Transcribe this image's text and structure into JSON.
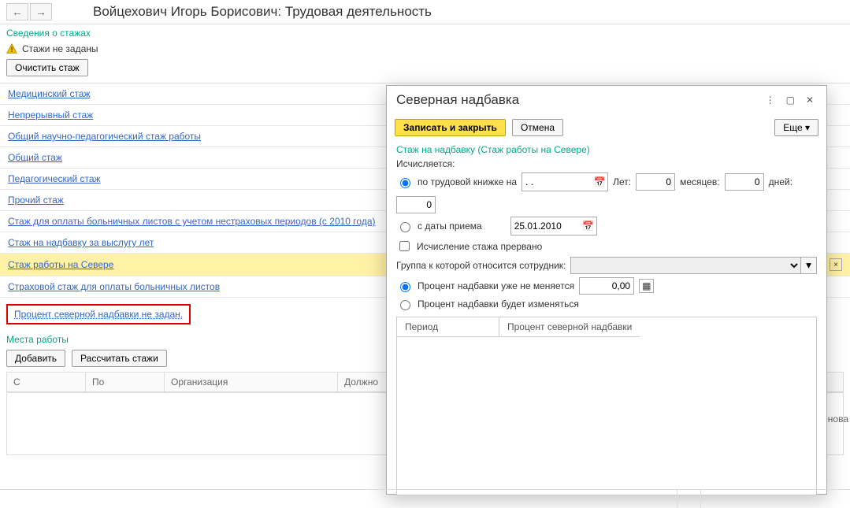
{
  "title": "Войцехович Игорь Борисович: Трудовая деятельность",
  "nav": {
    "back": "←",
    "forward": "→"
  },
  "stazh_info_link": "Сведения о стажах",
  "warn_text": "Стажи не заданы",
  "clear_btn": "Очистить стаж",
  "stages": [
    {
      "label": "Медицинский стаж"
    },
    {
      "label": "Непрерывный стаж"
    },
    {
      "label": "Общий научно-педагогический стаж работы"
    },
    {
      "label": "Общий стаж"
    },
    {
      "label": "Педагогический стаж"
    },
    {
      "label": "Прочий стаж"
    },
    {
      "label": "Стаж для оплаты больничных листов с учетом нестраховых периодов (с 2010 года)"
    },
    {
      "label": "Стаж на надбавку за выслугу лет"
    },
    {
      "label": "Стаж работы на Севере",
      "selected": true,
      "clearable": true
    },
    {
      "label": "Страховой стаж для оплаты больничных листов"
    }
  ],
  "percent_warning": "Процент северной надбавки не задан.",
  "places": {
    "header": "Места работы",
    "add": "Добавить",
    "calc": "Рассчитать стажи",
    "cols": {
      "from": "С",
      "to": "По",
      "org": "Организация",
      "pos": "Должно",
      "right": "аименова"
    }
  },
  "dialog": {
    "title": "Северная надбавка",
    "save": "Записать и закрыть",
    "cancel": "Отмена",
    "more": "Еще",
    "stazh_link": "Стаж на надбавку (Стаж работы на Севере)",
    "calc_label": "Исчисляется:",
    "by_book": "по трудовой книжке на",
    "by_hire": "с даты приема",
    "hire_date": "25.01.2010",
    "date_dots": ". .",
    "years": "Лет:",
    "years_v": "0",
    "months": "месяцев:",
    "months_v": "0",
    "days": "дней:",
    "days_v": "0",
    "interrupted": "Исчисление стажа прервано",
    "group_label": "Группа к которой относится сотрудник:",
    "pct_fixed": "Процент надбавки уже не меняется",
    "pct_value": "0,00",
    "pct_varies": "Процент надбавки будет изменяться",
    "tbl_period": "Период",
    "tbl_percent": "Процент северной надбавки"
  }
}
